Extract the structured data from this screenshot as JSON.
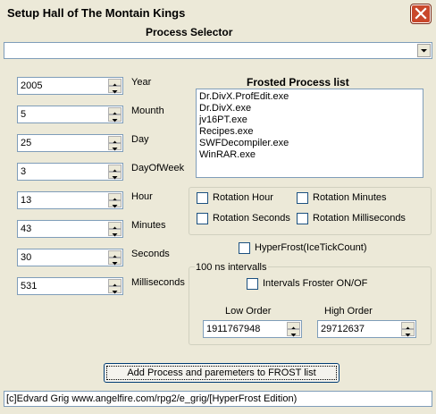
{
  "window": {
    "title": "Setup Hall of The Montain Kings",
    "close_icon": "close-icon"
  },
  "process_selector": {
    "label": "Process Selector",
    "value": ""
  },
  "fields": [
    {
      "label": "Year",
      "value": "2005"
    },
    {
      "label": "Mounth",
      "value": "5"
    },
    {
      "label": "Day",
      "value": "25"
    },
    {
      "label": "DayOfWeek",
      "value": "3"
    },
    {
      "label": "Hour",
      "value": "13"
    },
    {
      "label": "Minutes",
      "value": "43"
    },
    {
      "label": "Seconds",
      "value": "30"
    },
    {
      "label": "Milliseconds",
      "value": "531"
    }
  ],
  "frosted_list": {
    "label": "Frosted Process list",
    "items": [
      "Dr.DivX.ProfEdit.exe",
      "Dr.DivX.exe",
      "jv16PT.exe",
      "Recipes.exe",
      "SWFDecompiler.exe",
      "WinRAR.exe"
    ]
  },
  "rotation": {
    "hour": "Rotation Hour",
    "minutes": "Rotation Minutes",
    "seconds": "Rotation Seconds",
    "milliseconds": "Rotation Milliseconds"
  },
  "hyperfrost": "HyperFrost(IceTickCount)",
  "intervals": {
    "group_label": "100 ns intervalls",
    "toggle": "Intervals Froster ON/OF",
    "low_label": "Low Order",
    "low_value": "1911767948",
    "high_label": "High Order",
    "high_value": "29712637"
  },
  "add_button": "Add Process and paremeters to FROST list",
  "status": "[c]Edvard Grig www.angelfire.com/rpg2/e_grig/[HyperFrost Edition)"
}
